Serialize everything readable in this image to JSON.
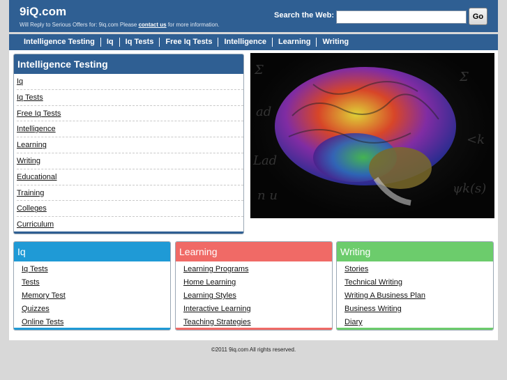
{
  "header": {
    "logo": "9iQ.com",
    "tagline_prefix": "Will Reply to Serious Offers for: 9iq.com Please ",
    "tagline_link": "contact us",
    "tagline_suffix": " for more information.",
    "search_label": "Search the Web:",
    "search_value": "",
    "go_label": "Go"
  },
  "nav": [
    "Intelligence Testing",
    "Iq",
    "Iq Tests",
    "Free Iq Tests",
    "Intelligence",
    "Learning",
    "Writing"
  ],
  "main_panel": {
    "title": "Intelligence Testing",
    "links": [
      "Iq",
      "Iq Tests",
      "Free Iq Tests",
      "Intelligence",
      "Learning",
      "Writing",
      "Educational",
      "Training",
      "Colleges",
      "Curriculum"
    ]
  },
  "columns": [
    {
      "title": "Iq",
      "color": "#1f9ad6",
      "links": [
        "Iq Tests",
        "Tests",
        "Memory Test",
        "Quizzes",
        "Online Tests"
      ]
    },
    {
      "title": "Learning",
      "color": "#f06a66",
      "links": [
        "Learning Programs",
        "Home Learning",
        "Learning Styles",
        "Interactive Learning",
        "Teaching Strategies"
      ]
    },
    {
      "title": "Writing",
      "color": "#6ccc6c",
      "links": [
        "Stories",
        "Technical Writing",
        "Writing A Business Plan",
        "Business Writing",
        "Diary"
      ]
    }
  ],
  "colors": {
    "brand": "#2f5f93"
  },
  "footer": "©2011 9iq.com All rights reserved."
}
